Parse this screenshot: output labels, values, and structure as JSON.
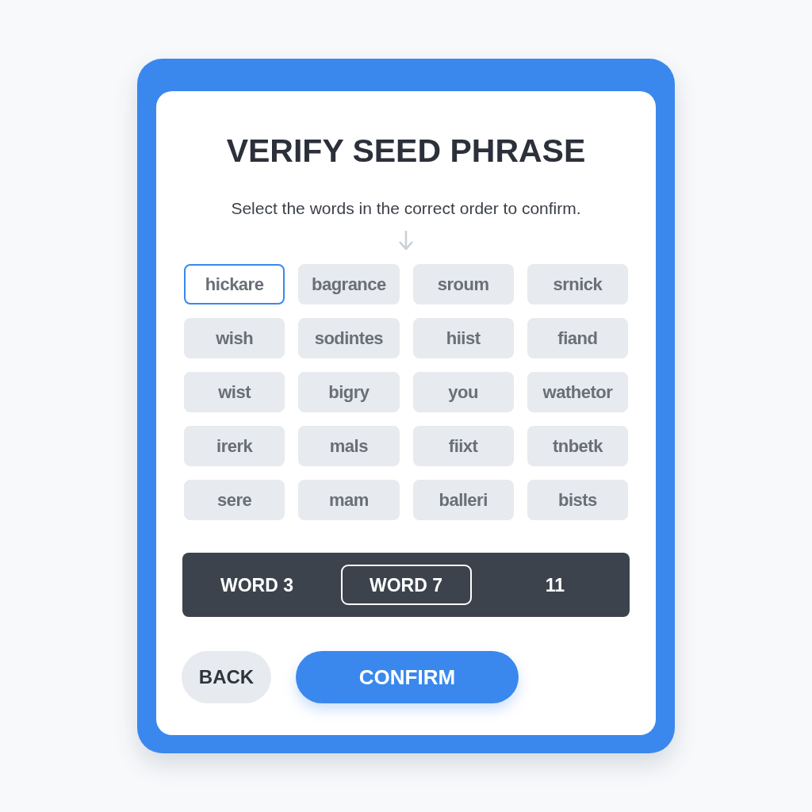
{
  "title": "VERIFY SEED PHRASE",
  "instruction": "Select the words in the correct order to confirm.",
  "words": [
    {
      "label": "hickare",
      "selected": true
    },
    {
      "label": "bagrance",
      "selected": false
    },
    {
      "label": "sroum",
      "selected": false
    },
    {
      "label": "srnick",
      "selected": false
    },
    {
      "label": "wish",
      "selected": false
    },
    {
      "label": "sodintes",
      "selected": false
    },
    {
      "label": "hiist",
      "selected": false
    },
    {
      "label": "fiand",
      "selected": false
    },
    {
      "label": "wist",
      "selected": false
    },
    {
      "label": "bigry",
      "selected": false
    },
    {
      "label": "you",
      "selected": false
    },
    {
      "label": "wathetor",
      "selected": false
    },
    {
      "label": "irerk",
      "selected": false
    },
    {
      "label": "mals",
      "selected": false
    },
    {
      "label": "fiixt",
      "selected": false
    },
    {
      "label": "tnbetk",
      "selected": false
    },
    {
      "label": "sere",
      "selected": false
    },
    {
      "label": "mam",
      "selected": false
    },
    {
      "label": "balleri",
      "selected": false
    },
    {
      "label": "bists",
      "selected": false
    }
  ],
  "slots": [
    {
      "label": "WORD 3",
      "selected": false
    },
    {
      "label": "WORD 7",
      "selected": true
    },
    {
      "label": "11",
      "selected": false
    }
  ],
  "buttons": [
    {
      "label": "BACK",
      "kind": "secondary"
    },
    {
      "label": "CONFIRM",
      "kind": "primary"
    }
  ]
}
